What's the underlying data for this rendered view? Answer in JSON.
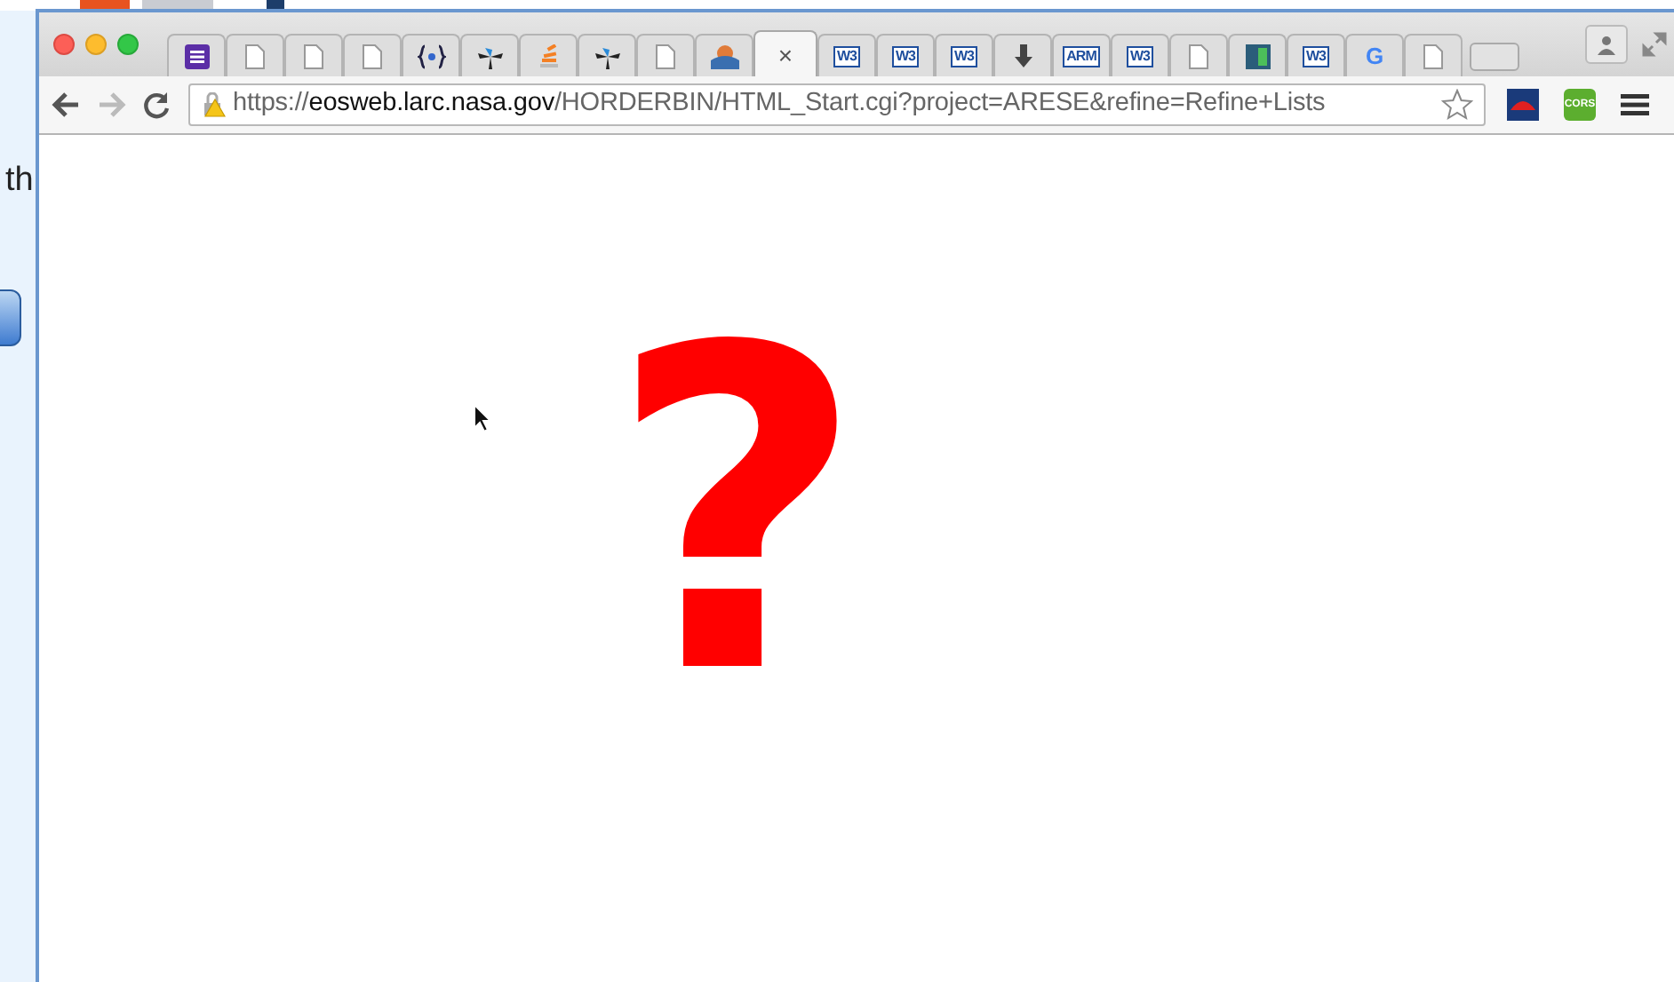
{
  "background_page": {
    "text": "th"
  },
  "tabs": [
    {
      "kind": "list",
      "selected": false
    },
    {
      "kind": "page",
      "selected": false
    },
    {
      "kind": "page",
      "selected": false
    },
    {
      "kind": "page",
      "selected": false
    },
    {
      "kind": "code",
      "selected": false
    },
    {
      "kind": "pinwheel",
      "selected": false
    },
    {
      "kind": "stack",
      "selected": false
    },
    {
      "kind": "pinwheel",
      "selected": false
    },
    {
      "kind": "page",
      "selected": false
    },
    {
      "kind": "picture",
      "selected": false
    },
    {
      "kind": "close",
      "selected": true,
      "label": "×"
    },
    {
      "kind": "logo",
      "label": "W3",
      "selected": false
    },
    {
      "kind": "logo",
      "label": "W3",
      "selected": false
    },
    {
      "kind": "logo",
      "label": "W3",
      "selected": false
    },
    {
      "kind": "download",
      "selected": false
    },
    {
      "kind": "logo",
      "label": "ARM",
      "selected": false
    },
    {
      "kind": "logo",
      "label": "W3",
      "selected": false
    },
    {
      "kind": "page",
      "selected": false
    },
    {
      "kind": "square",
      "selected": false
    },
    {
      "kind": "logo",
      "label": "W3",
      "selected": false
    },
    {
      "kind": "g",
      "label": "G",
      "selected": false
    },
    {
      "kind": "page",
      "selected": false
    }
  ],
  "address_bar": {
    "scheme": "https://",
    "host": "eosweb.larc.nasa.gov",
    "path": "/HORDERBIN/HTML_Start.cgi?project=ARESE&refine=Refine+Lists"
  },
  "extensions": [
    {
      "kind": "red"
    },
    {
      "kind": "cors",
      "label": "CORS"
    }
  ],
  "content": {
    "symbol": "?"
  }
}
